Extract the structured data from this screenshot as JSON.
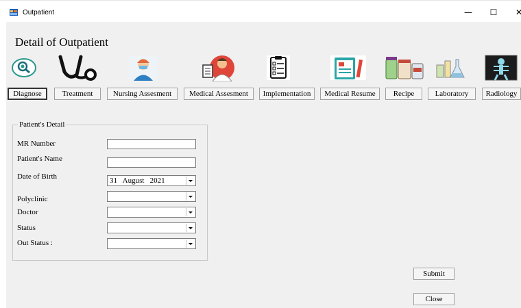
{
  "window": {
    "title": "Outpatient",
    "minimize_glyph": "—",
    "maximize_glyph": "☐",
    "close_glyph": "✕"
  },
  "page": {
    "title": "Detail of Outpatient"
  },
  "nav": [
    {
      "label": "Diagnose",
      "icon": "magnifier-icon",
      "active": true
    },
    {
      "label": "Treatment",
      "icon": "stethoscope-icon"
    },
    {
      "label": "Nursing Assesment",
      "icon": "nurse-icon"
    },
    {
      "label": "Medical Assesment",
      "icon": "doctor-icon"
    },
    {
      "label": "Implementation",
      "icon": "clipboard-icon"
    },
    {
      "label": "Medical Resume",
      "icon": "medical-record-icon"
    },
    {
      "label": "Recipe",
      "icon": "medicine-bottles-icon"
    },
    {
      "label": "Laboratory",
      "icon": "lab-flask-icon"
    },
    {
      "label": "Radiology",
      "icon": "xray-icon"
    }
  ],
  "patient": {
    "group_title": "Patient's Detail",
    "mr_number": {
      "label": "MR Number",
      "value": ""
    },
    "name": {
      "label": "Patient's Name",
      "value": ""
    },
    "dob": {
      "label": "Date of Birth",
      "value": "31   August   2021"
    },
    "polyclinic": {
      "label": "Polyclinic",
      "value": ""
    },
    "doctor": {
      "label": "Doctor",
      "value": ""
    },
    "status": {
      "label": "Status",
      "value": ""
    },
    "out_status": {
      "label": "Out Status :",
      "value": ""
    }
  },
  "actions": {
    "submit": "Submit",
    "close": "Close"
  },
  "colors": {
    "client_bg": "#f0f0f0",
    "window_bg": "#ffffff"
  }
}
